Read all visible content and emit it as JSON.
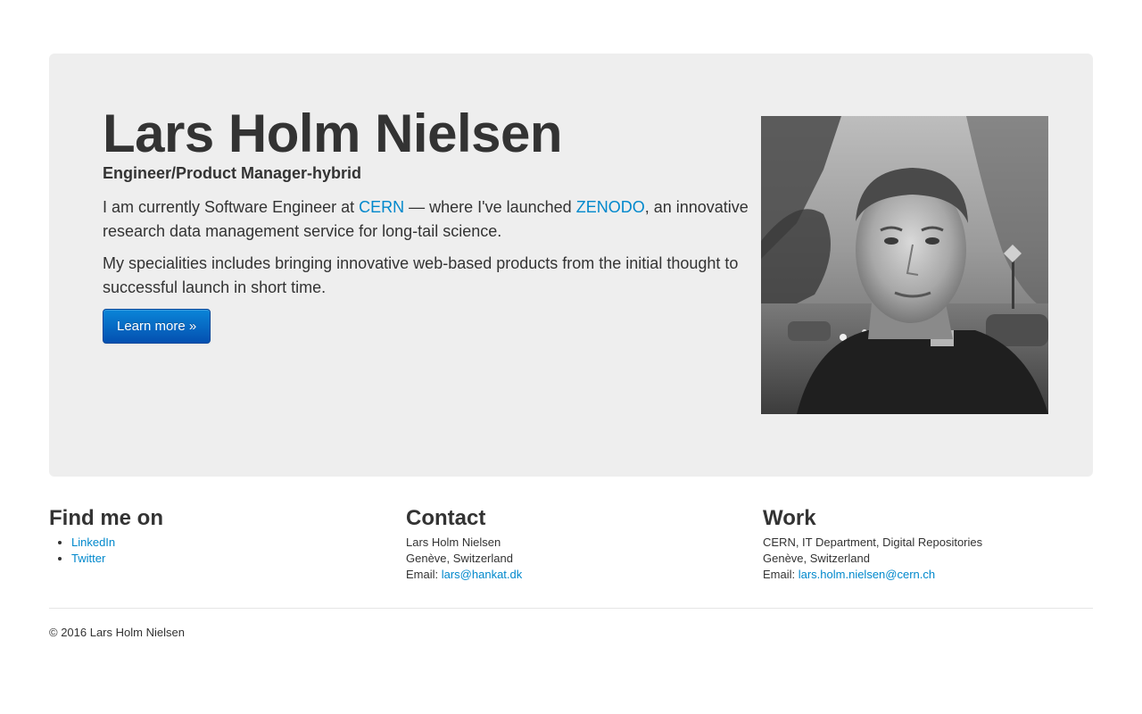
{
  "hero": {
    "title": "Lars Holm Nielsen",
    "subtitle": "Engineer/Product Manager-hybrid",
    "p1": {
      "before": "I am currently Software Engineer at ",
      "link1": "CERN",
      "middle": " — where I've launched ",
      "link2": "ZENODO",
      "after": ", an innovative research data management service for long-tail science."
    },
    "p2": "My specialities includes bringing innovative web-based products from the initial thought to successful launch in short time.",
    "button_label": "Learn more »"
  },
  "find_me": {
    "title": "Find me on",
    "links": [
      "LinkedIn",
      "Twitter"
    ]
  },
  "contact": {
    "title": "Contact",
    "name": "Lars Holm Nielsen",
    "location": "Genève, Switzerland",
    "email_label": "Email: ",
    "email": "lars@hankat.dk"
  },
  "work": {
    "title": "Work",
    "org": "CERN, IT Department, Digital Repositories",
    "location": "Genève, Switzerland",
    "email_label": "Email: ",
    "email": "lars.holm.nielsen@cern.ch"
  },
  "footer": {
    "copyright": "© 2016 Lars Holm Nielsen"
  },
  "colors": {
    "link": "#0088cc",
    "hero_bg": "#eeeeee",
    "button": "#0a6fc9"
  }
}
